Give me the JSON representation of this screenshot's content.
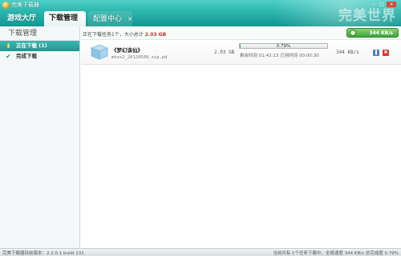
{
  "window": {
    "title": "完美下载器",
    "brand_logo": "完美世界"
  },
  "tabs": [
    {
      "label": "游戏大厅"
    },
    {
      "label": "下载管理"
    },
    {
      "label": "配置中心",
      "close": "×"
    }
  ],
  "window_controls": {
    "minimize": "–",
    "maximize": "□",
    "close": "×"
  },
  "sidebar": {
    "title": "下载管理",
    "items": [
      {
        "label": "正在下载 (1)",
        "icon": "arrow-down-icon",
        "active": true
      },
      {
        "label": "完成下载",
        "icon": "check-icon",
        "active": false
      }
    ]
  },
  "summary": {
    "prefix": "正在下载任务1个，大小总计",
    "total_size": "2.03 GB",
    "speed": "344 KB/s"
  },
  "tasks": [
    {
      "name": "《梦幻诛仙》",
      "file": "mhzx2_20120509.zip.pd",
      "size": "2.03 GB",
      "progress_label": "0.79%",
      "progress_fraction": 0.0079,
      "time": "剩余时间 01:42:13 已用时间 00:00:30",
      "speed": "344 KB/s"
    }
  ],
  "status": {
    "left": "完美下载器目前版本：2.2.0.1 build 131.",
    "right": "当前共有 1个任务下载中，全局速度 344 KB/s 总完成度 0.79%"
  },
  "colors": {
    "header_top": "#4fd0c8",
    "header_bottom": "#15968f",
    "accent": "#22968f",
    "size_highlight": "#e02020",
    "progress": "#4ec04e"
  }
}
